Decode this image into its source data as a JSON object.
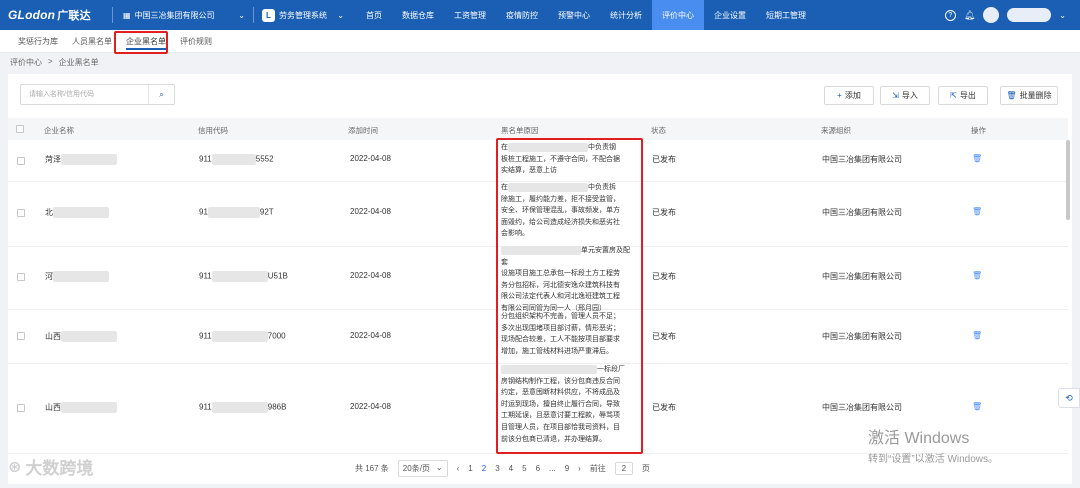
{
  "header": {
    "logo_text": "GLodon",
    "logo_cn": "广联达",
    "company": "中国三冶集团有限公司",
    "system_badge": "L",
    "system": "劳务管理系统",
    "nav": [
      "首页",
      "数据仓库",
      "工资管理",
      "疫情防控",
      "预警中心",
      "统计分析",
      "评价中心",
      "企业设置",
      "短期工管理"
    ],
    "active_nav": "评价中心",
    "help_icon": "?"
  },
  "subtabs": [
    "奖惩行为库",
    "人员黑名单",
    "企业黑名单",
    "评价规则"
  ],
  "breadcrumb": [
    "评价中心",
    ">",
    "企业黑名单"
  ],
  "search": {
    "placeholder": "请输入名称/信用代码"
  },
  "toolbar": {
    "add": "添加",
    "import": "导入",
    "export": "导出",
    "batch_delete": "批量删除"
  },
  "table": {
    "columns": [
      "企业名称",
      "信用代码",
      "添加时间",
      "黑名单原因",
      "状态",
      "来源组织",
      "操作"
    ],
    "rows": [
      {
        "name": "菏泽",
        "code_prefix": "911",
        "code_suffix": "5552",
        "date": "2022-04-08",
        "reason": [
          "在",
          "中负责钢",
          "板桩工程施工，不遵守合同，不配合据",
          "实结算，恶意上访"
        ],
        "status": "已发布",
        "org": "中国三冶集团有限公司"
      },
      {
        "name": "北",
        "code_prefix": "91",
        "code_suffix": "92T",
        "date": "2022-04-08",
        "reason": [
          "在",
          "中负责拆",
          "除施工，履约能力差，拒不接受监管，",
          "安全、环保管理混乱，事故频发，单方",
          "面毁约，给公司造成经济损失和恶劣社",
          "会影响。"
        ],
        "status": "已发布",
        "org": "中国三冶集团有限公司"
      },
      {
        "name": "河",
        "code_prefix": "911",
        "code_suffix": "U51B",
        "date": "2022-04-08",
        "reason": [
          "单元安置房及配套",
          "设施项目施工总承包一标段土方工程劳",
          "务分包招标，河北德安逸众建筑科技有",
          "限公司法定代表人和河北逸班建筑工程",
          "有限公司同管为同一人（邢月园）"
        ],
        "status": "已发布",
        "org": "中国三冶集团有限公司"
      },
      {
        "name": "山西",
        "code_prefix": "911",
        "code_suffix": "7000",
        "date": "2022-04-08",
        "reason": [
          "分包组织架构不完善，管理人员不足；",
          "多次出现围堵项目部讨薪，情形恶劣；",
          "现场配合较差，工人不能按项目部要求",
          "增加，施工管线材料进场严重滞后。"
        ],
        "status": "已发布",
        "org": "中国三冶集团有限公司"
      },
      {
        "name": "山西",
        "code_prefix": "911",
        "code_suffix": "986B",
        "date": "2022-04-08",
        "reason": [
          "一标段厂",
          "房钢结构制作工程，该分包商违反合同",
          "约定，恶意囤断材料供应，不将成品及",
          "时运到现场，擅自终止履行合同，导致",
          "工期延误，且恶意讨要工程款，辱骂项",
          "目管理人员，在项目部恰我司资料，目",
          "前该分包商已清退，并办理结算。"
        ],
        "status": "已发布",
        "org": "中国三冶集团有限公司"
      }
    ]
  },
  "pagination": {
    "total": "共 167 条",
    "page_size": "20条/页",
    "prev": "‹",
    "pages": [
      "1",
      "2",
      "3",
      "4",
      "5",
      "6",
      "...",
      "9"
    ],
    "current": "2",
    "next": "›",
    "goto_label": "前往",
    "goto_value": "2",
    "goto_suffix": "页"
  },
  "watermark": {
    "line1": "激活 Windows",
    "line2": "转到“设置”以激活 Windows。"
  },
  "brand_watermark": "大数跨境"
}
